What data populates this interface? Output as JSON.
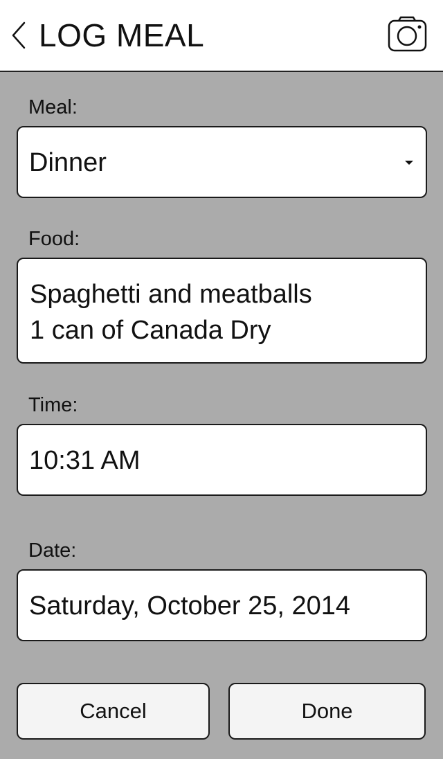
{
  "header": {
    "title": "LOG MEAL",
    "back_icon": "chevron-left-icon",
    "camera_icon": "camera-icon"
  },
  "form": {
    "meal": {
      "label": "Meal:",
      "value": "Dinner"
    },
    "food": {
      "label": "Food:",
      "lines": [
        "Spaghetti and meatballs",
        "1 can of Canada Dry"
      ]
    },
    "time": {
      "label": "Time:",
      "value": "10:31 AM"
    },
    "date": {
      "label": "Date:",
      "value": "Saturday, October 25, 2014"
    }
  },
  "actions": {
    "cancel_label": "Cancel",
    "done_label": "Done"
  },
  "colors": {
    "background": "#ababab",
    "header": "#ffffff",
    "field": "#ffffff",
    "button": "#f4f4f4",
    "border": "#1a1a1a"
  }
}
